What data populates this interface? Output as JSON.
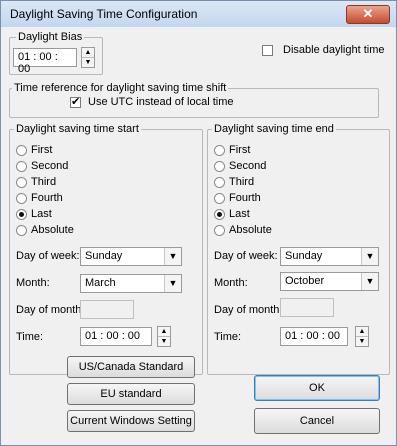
{
  "window": {
    "title": "Daylight Saving Time Configuration",
    "close_glyph": "✕"
  },
  "bias": {
    "label": "Daylight Bias",
    "value": "01 : 00 : 00"
  },
  "disable": {
    "label": "Disable daylight time",
    "checked": false
  },
  "timeref": {
    "label": "Time reference for daylight saving time shift",
    "utc_label": "Use UTC instead of local time",
    "utc_checked": true
  },
  "start": {
    "label": "Daylight saving time start",
    "options": [
      "First",
      "Second",
      "Third",
      "Fourth",
      "Last",
      "Absolute"
    ],
    "selected": "Last",
    "dow_label": "Day of week:",
    "dow_value": "Sunday",
    "month_label": "Month:",
    "month_value": "March",
    "dom_label": "Day of month:",
    "dom_value": "",
    "time_label": "Time:",
    "time_value": "01 : 00 : 00"
  },
  "end": {
    "label": "Daylight saving time end",
    "options": [
      "First",
      "Second",
      "Third",
      "Fourth",
      "Last",
      "Absolute"
    ],
    "selected": "Last",
    "dow_label": "Day of week:",
    "dow_value": "Sunday",
    "month_label": "Month:",
    "month_value": "October",
    "dom_label": "Day of month:",
    "dom_value": "",
    "time_label": "Time:",
    "time_value": "01 : 00 : 00"
  },
  "buttons": {
    "us_canada": "US/Canada Standard",
    "eu": "EU standard",
    "current": "Current Windows Setting",
    "ok": "OK",
    "cancel": "Cancel"
  },
  "icons": {
    "spin_up": "▲",
    "spin_down": "▼",
    "dropdown": "▼"
  }
}
